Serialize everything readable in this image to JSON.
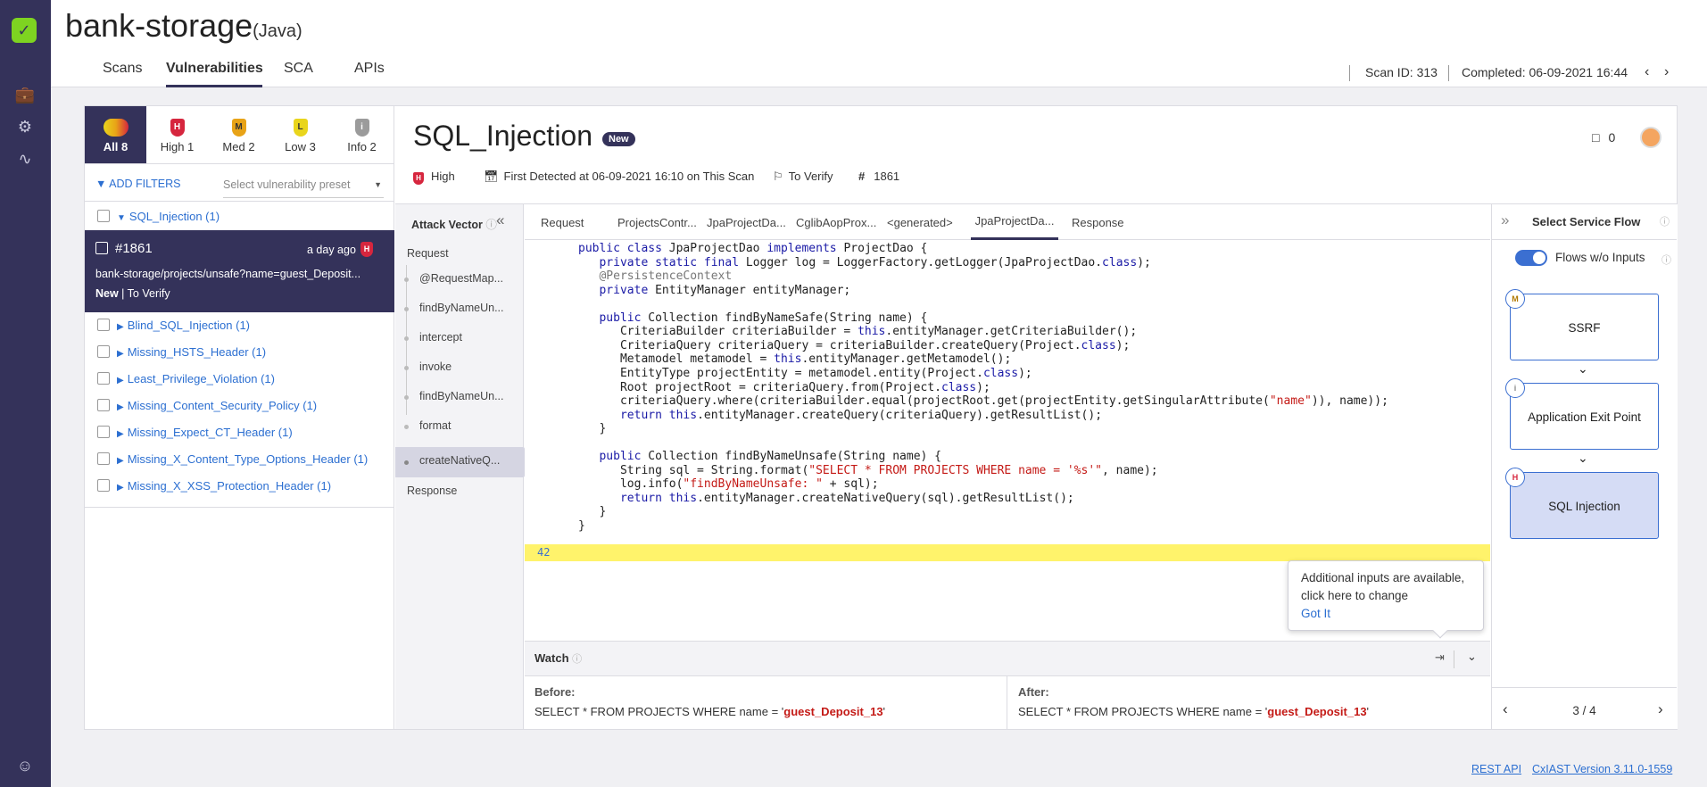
{
  "project": {
    "name": "bank-storage",
    "language": "(Java)"
  },
  "nav_tabs": [
    {
      "label": "Scans"
    },
    {
      "label": "Vulnerabilities"
    },
    {
      "label": "SCA"
    },
    {
      "label": "APIs"
    }
  ],
  "scan": {
    "id_label": "Scan ID: 313",
    "completed_label": "Completed: 06-09-2021 16:44"
  },
  "severity_tabs": [
    {
      "label": "All 8",
      "badge": ""
    },
    {
      "label": "High 1",
      "badge": "H"
    },
    {
      "label": "Med 2",
      "badge": "M"
    },
    {
      "label": "Low 3",
      "badge": "L"
    },
    {
      "label": "Info 2",
      "badge": "i"
    }
  ],
  "filters": {
    "add_label": "ADD FILTERS",
    "preset_placeholder": "Select vulnerability preset"
  },
  "vulnerabilities": [
    {
      "label": "SQL_Injection (1)"
    },
    {
      "label": "Blind_SQL_Injection (1)"
    },
    {
      "label": "Missing_HSTS_Header (1)"
    },
    {
      "label": "Least_Privilege_Violation (1)"
    },
    {
      "label": "Missing_Content_Security_Policy (1)"
    },
    {
      "label": "Missing_Expect_CT_Header (1)"
    },
    {
      "label": "Missing_X_Content_Type_Options_Header (1)"
    },
    {
      "label": "Missing_X_XSS_Protection_Header (1)"
    }
  ],
  "selected_item": {
    "id": "#1861",
    "time": "a day ago",
    "badge": "H",
    "url": "bank-storage/projects/unsafe?name=guest_Deposit...",
    "state": "New",
    "status": "To Verify"
  },
  "detail": {
    "title": "SQL_Injection",
    "state_badge": "New",
    "severity": "High",
    "first_detected": "First Detected at 06-09-2021 16:10 on This Scan",
    "status": "To Verify",
    "id": "1861",
    "comments": "0"
  },
  "attack_vector": {
    "title": "Attack Vector",
    "nodes": [
      "Request",
      "@RequestMap...",
      "findByNameUn...",
      "intercept",
      "invoke",
      "findByNameUn...",
      "format",
      "createNativeQ...",
      "Response"
    ]
  },
  "code_tabs": [
    "Request",
    "ProjectsContr...",
    "JpaProjectDa...",
    "CglibAopProx...",
    "<generated>",
    "JpaProjectDa...",
    "Response"
  ],
  "code": {
    "highlight_line": "42",
    "lines": [
      "public class JpaProjectDao implements ProjectDao {",
      "   private static final Logger log = LoggerFactory.getLogger(JpaProjectDao.class);",
      "   @PersistenceContext",
      "   private EntityManager entityManager;",
      "",
      "   public Collection findByNameSafe(String name) {",
      "      CriteriaBuilder criteriaBuilder = this.entityManager.getCriteriaBuilder();",
      "      CriteriaQuery criteriaQuery = criteriaBuilder.createQuery(Project.class);",
      "      Metamodel metamodel = this.entityManager.getMetamodel();",
      "      EntityType projectEntity = metamodel.entity(Project.class);",
      "      Root projectRoot = criteriaQuery.from(Project.class);",
      "      criteriaQuery.where(criteriaBuilder.equal(projectRoot.get(projectEntity.getSingularAttribute(\"name\")), name));",
      "      return this.entityManager.createQuery(criteriaQuery).getResultList();",
      "   }",
      "",
      "   public Collection findByNameUnsafe(String name) {",
      "      String sql = String.format(\"SELECT * FROM PROJECTS WHERE name = '%s'\", name);",
      "      log.info(\"findByNameUnsafe: \" + sql);",
      "      return this.entityManager.createNativeQuery(sql).getResultList();",
      "   }",
      "}"
    ]
  },
  "tooltip": {
    "text1": "Additional inputs are available,",
    "text2": "click here to change",
    "action": "Got It"
  },
  "watch": {
    "title": "Watch",
    "before_label": "Before:",
    "after_label": "After:",
    "before_prefix": "SELECT * FROM PROJECTS WHERE name = '",
    "before_value": "guest_Deposit_13",
    "before_suffix": "'",
    "after_prefix": "SELECT * FROM PROJECTS WHERE name = '",
    "after_value": "guest_Deposit_13",
    "after_suffix": "'"
  },
  "service_flow": {
    "title": "Select Service Flow",
    "toggle_label": "Flows w/o Inputs",
    "flows": [
      {
        "label": "SSRF",
        "badge": "M"
      },
      {
        "label": "Application Exit Point",
        "badge": "i"
      },
      {
        "label": "SQL Injection",
        "badge": "H"
      }
    ],
    "pager": "3 / 4"
  },
  "footer": {
    "rest_api": "REST API",
    "version": "CxIAST Version 3.11.0-1559"
  },
  "colors": {
    "rail": "#34325a",
    "link": "#2c6fd1",
    "high": "#d6263e",
    "medium": "#e8a317",
    "low": "#e9d51c",
    "info": "#9b9b9b",
    "highlight": "#fff36b"
  }
}
